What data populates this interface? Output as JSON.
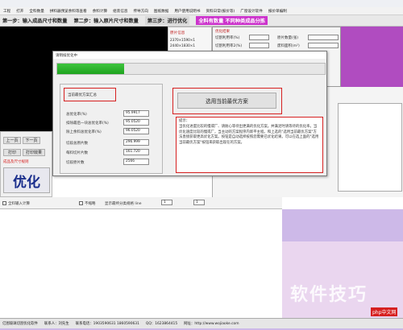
{
  "menu": [
    "工程",
    "打开",
    "全料数量",
    "拼料器预览余料等查看",
    "余料计算",
    "组装信息",
    "传导方向",
    "图纸数据",
    "用户使用说明书",
    "资料日常(报价等)",
    "广窗设计软件",
    "报价单编制"
  ],
  "steps": {
    "s1": "第一步：输入成品尺寸和数量",
    "s2": "第二步：输入原片尺寸和数量",
    "s3": "第三步：进行优化",
    "s4": "全料有数量  不同种类成品分拣"
  },
  "mid_panel": {
    "title": "原片信息",
    "line1": "2370×1590×1",
    "line2": "2440×1830×1"
  },
  "right_panel": {
    "title": "优化结果",
    "rate_label": "切割利用率(%)",
    "rate2_label": "切割利用率2(%)",
    "waste_label": "废料面积(m²)",
    "count_label": "原片数量(张)"
  },
  "dialog": {
    "title": "请稍候优化中",
    "progress": 0.25,
    "best_group_title": "当前最优方案汇总",
    "fields": [
      {
        "label": "总优化率(%)",
        "value": "95.9917"
      },
      {
        "label": "扣除最后一块总优化率(%)",
        "value": "95.0520"
      },
      {
        "label": "除上余料总优化率(%)",
        "value": "96.0520"
      },
      {
        "label": "切段总原片数",
        "value": "296.999"
      },
      {
        "label": "每料切片片数",
        "value": "161.720"
      },
      {
        "label": "切段原片数",
        "value": "2566"
      }
    ],
    "use_button": "选用当前最优方案",
    "note_title": "提示：",
    "note_body": "当优化进度比较的慢或厂、请耐心等待出更满的优化方案。并满足时请等待的优化率。当优化速度比较的慢或厂，当主动的方案程序内新平主程。和上选的\"选用当前最优方案\"方法直接获取更高优化方案。按钮是自动选择按照您需要已优化结果。可以在选上面的\"选用当前最优方案\"按钮来获取出现在的方案。"
  },
  "left_area": {
    "page_label": "上一页",
    "next_label": "下一页",
    "print_label": "打印",
    "print2_label": "打印效果",
    "red_text": "成品及尺寸规则",
    "optimize_label": "优化"
  },
  "bottom_options": {
    "check1": "全料输入计算",
    "check2": "不缩略",
    "check3": "显示最终分类规格 line",
    "spin_value": "1"
  },
  "watermark": "软件技巧",
  "watermark_site": "php中文网",
  "status": [
    "亿图玻璃切割优化软件",
    "联系人：刘先生",
    "联系电话：1903590631 1860590631",
    "QQ：1623864415",
    "网址：http://www.wojiaoke.com"
  ]
}
